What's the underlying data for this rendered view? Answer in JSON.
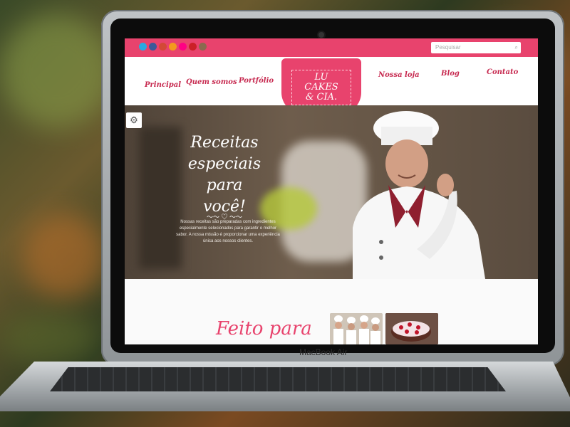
{
  "device": {
    "brand_label": "MacBook Air"
  },
  "site": {
    "search": {
      "placeholder": "Pesquisar"
    },
    "social_icons": [
      "twitter-icon",
      "facebook-icon",
      "google-plus-icon",
      "rss-icon",
      "flickr-icon",
      "pinterest-icon",
      "instagram-icon"
    ],
    "nav": {
      "left": [
        "Principal",
        "Quem somos",
        "Portfólio"
      ],
      "right": [
        "Nossa loja",
        "Blog",
        "Contato"
      ]
    },
    "logo": {
      "line1": "LU",
      "line2": "CAKES",
      "line3": "& CIA."
    },
    "hero": {
      "headline_line1": "Receitas",
      "headline_line2": "especiais para",
      "headline_line3": "você!",
      "body": "Nossas receitas são preparadas com ingredientes especialmente selecionados para garantir o melhor sabor. A nossa missão é proporcionar uma experiência única aos nossos clientes."
    },
    "section": {
      "heading": "Feito para"
    },
    "colors": {
      "accent": "#e8436d",
      "accent_dark": "#c72a50"
    }
  }
}
